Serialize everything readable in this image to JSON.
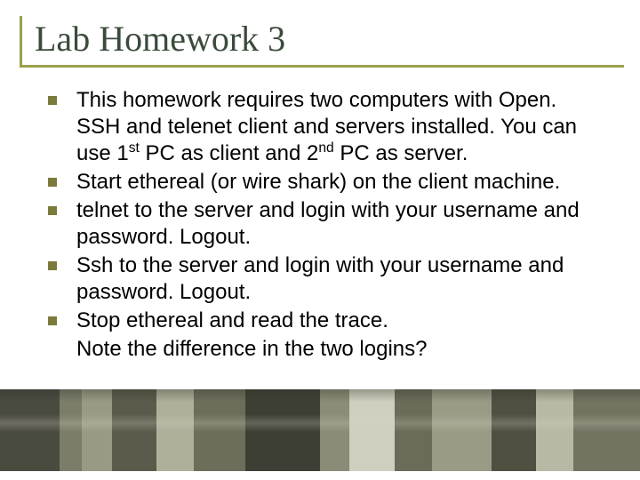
{
  "title": "Lab Homework 3",
  "bullets": [
    {
      "pre": "This homework requires two computers with Open. SSH and telenet client and servers installed. You can use 1",
      "sup1": "st",
      "mid": " PC as client and 2",
      "sup2": "nd",
      "post": " PC as server."
    },
    {
      "text": "Start ethereal (or wire shark) on the client machine."
    },
    {
      "text": "telnet to the server and login with your username and password. Logout."
    },
    {
      "text": "Ssh to the server and login with your username and password. Logout."
    },
    {
      "text": "Stop ethereal and read the trace."
    }
  ],
  "note": "Note the difference in the two logins?"
}
